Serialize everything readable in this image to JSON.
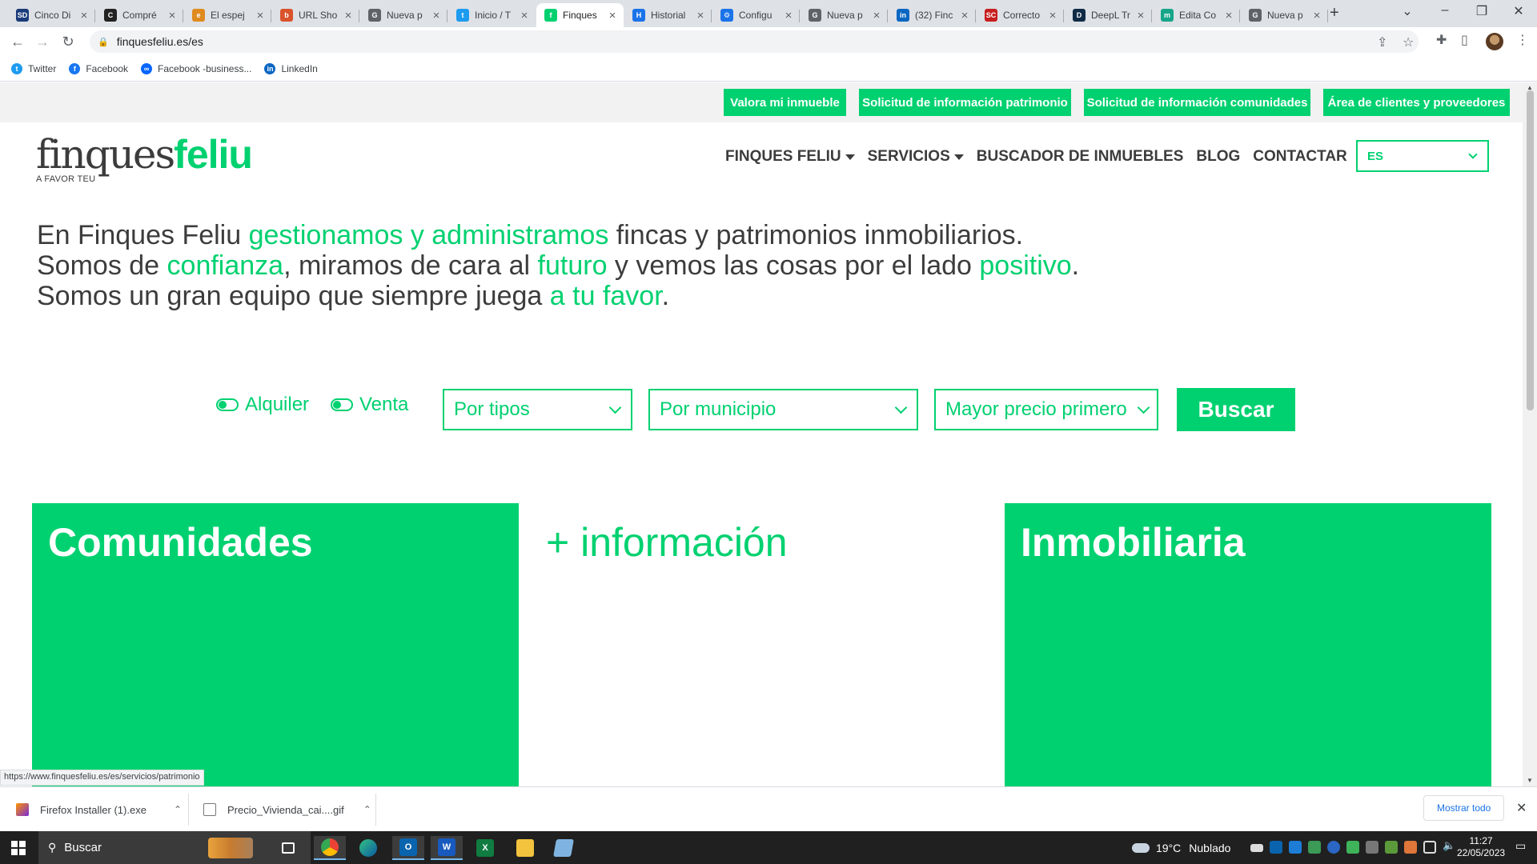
{
  "browser": {
    "tabs": [
      {
        "title": "Cinco Di",
        "fav": "SD",
        "color": "#1a3b7a"
      },
      {
        "title": "Compré",
        "fav": "C",
        "color": "#222222"
      },
      {
        "title": "El espej",
        "fav": "e",
        "color": "#e08a1e"
      },
      {
        "title": "URL Sho",
        "fav": "b",
        "color": "#d9532c"
      },
      {
        "title": "Nueva p",
        "fav": "G",
        "color": "#5f6368"
      },
      {
        "title": "Inicio / T",
        "fav": "t",
        "color": "#1d9bf0"
      },
      {
        "title": "Finques",
        "fav": "f",
        "color": "#00d170"
      },
      {
        "title": "Historial",
        "fav": "H",
        "color": "#1a73e8"
      },
      {
        "title": "Configu",
        "fav": "⚙",
        "color": "#1a73e8"
      },
      {
        "title": "Nueva p",
        "fav": "G",
        "color": "#5f6368"
      },
      {
        "title": "(32) Finc",
        "fav": "in",
        "color": "#0a66c2"
      },
      {
        "title": "Correcto",
        "fav": "SC",
        "color": "#c81e1e"
      },
      {
        "title": "DeepL Tr",
        "fav": "D",
        "color": "#0f2b46"
      },
      {
        "title": "Edita Co",
        "fav": "m",
        "color": "#17a589"
      },
      {
        "title": "Nueva p",
        "fav": "G",
        "color": "#5f6368"
      }
    ],
    "url": "finquesfeliu.es/es",
    "bookmarks": [
      {
        "label": "Twitter",
        "color": "#1d9bf0",
        "glyph": "t"
      },
      {
        "label": "Facebook",
        "color": "#1877f2",
        "glyph": "f"
      },
      {
        "label": "Facebook -business...",
        "color": "#0866ff",
        "glyph": "∞"
      },
      {
        "label": "LinkedIn",
        "color": "#0a66c2",
        "glyph": "in"
      }
    ],
    "status_url": "https://www.finquesfeliu.es/es/servicios/patrimonio"
  },
  "site": {
    "top_buttons": [
      "Valora mi inmueble",
      "Solicitud de información patrimonio",
      "Solicitud de información comunidades",
      "Área de clientes y proveedores"
    ],
    "logo": {
      "part1": "finques",
      "part2": "feliu",
      "tagline": "A FAVOR TEU"
    },
    "nav": [
      "FINQUES FELIU",
      "SERVICIOS",
      "BUSCADOR DE INMUEBLES",
      "BLOG",
      "CONTACTAR"
    ],
    "language": "ES",
    "intro": {
      "l1a": "En Finques Feliu ",
      "l1b": "gestionamos y administramos",
      "l1c": " fincas y patrimonios inmobiliarios.",
      "l2a": "Somos de ",
      "l2b": "confianza",
      "l2c": ", miramos de cara al ",
      "l2d": "futuro",
      "l2e": " y vemos las cosas por el lado ",
      "l2f": "positivo",
      "l2g": ".",
      "l3a": "Somos un gran equipo que siempre juega ",
      "l3b": "a tu favor",
      "l3c": "."
    },
    "search": {
      "toggle_alquiler": "Alquiler",
      "toggle_venta": "Venta",
      "type_select": "Por tipos",
      "municipality_select": "Por municipio",
      "order_select": "Mayor precio primero",
      "search_button": "Buscar"
    },
    "cards": {
      "comunidades": "Comunidades",
      "info": "+ información",
      "inmobiliaria": "Inmobiliaria"
    }
  },
  "downloads": {
    "items": [
      "Firefox Installer (1).exe",
      "Precio_Vivienda_cai....gif"
    ],
    "show_all": "Mostrar todo"
  },
  "taskbar": {
    "search_placeholder": "Buscar",
    "weather_temp": "19°C",
    "weather_text": "Nublado",
    "time": "11:27",
    "date": "22/05/2023"
  },
  "colors": {
    "brand_green": "#00d170",
    "text_dark": "#3c3c3c"
  }
}
